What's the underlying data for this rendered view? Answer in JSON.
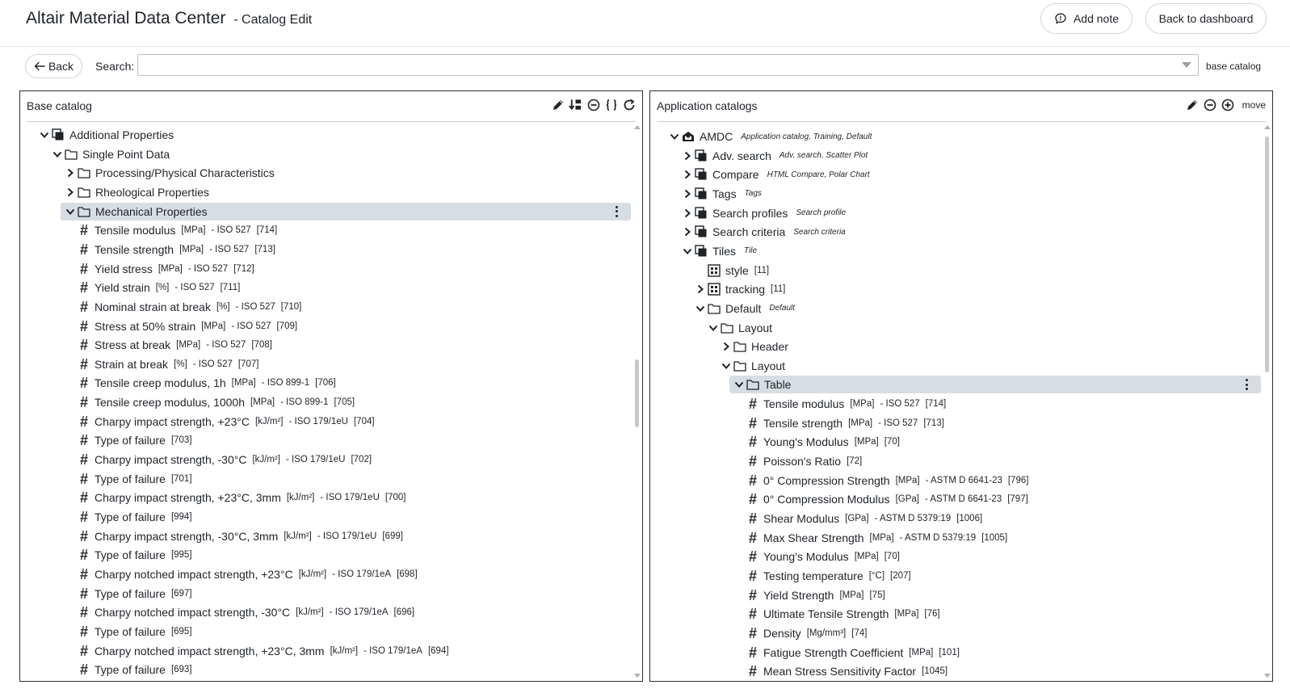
{
  "header": {
    "app_title": "Altair Material Data Center",
    "page_subtitle": "- Catalog Edit",
    "add_note_label": "Add note",
    "dashboard_label": "Back to dashboard"
  },
  "toolbar": {
    "back_label": "Back",
    "search_label": "Search:",
    "search_value": "",
    "search_scope": "base catalog"
  },
  "left_panel": {
    "title": "Base catalog",
    "tools": [
      "pencil-icon",
      "sort-icon",
      "collapse-all-icon",
      "braces-icon",
      "refresh-icon"
    ],
    "rows": [
      {
        "level": 1,
        "expand": "open",
        "icon": "catalog",
        "label": "Additional Properties"
      },
      {
        "level": 2,
        "expand": "open",
        "icon": "folder",
        "label": "Single Point Data"
      },
      {
        "level": 3,
        "expand": "closed",
        "icon": "folder",
        "label": "Processing/Physical Characteristics"
      },
      {
        "level": 3,
        "expand": "closed",
        "icon": "folder",
        "label": "Rheological Properties"
      },
      {
        "level": 3,
        "expand": "open",
        "icon": "folder",
        "label": "Mechanical Properties",
        "selected": true
      },
      {
        "level": 4,
        "icon": "hash",
        "label": "Tensile modulus",
        "unit": "[MPa]",
        "std": "- ISO 527",
        "id": "[714]"
      },
      {
        "level": 4,
        "icon": "hash",
        "label": "Tensile strength",
        "unit": "[MPa]",
        "std": "- ISO 527",
        "id": "[713]"
      },
      {
        "level": 4,
        "icon": "hash",
        "label": "Yield stress",
        "unit": "[MPa]",
        "std": "- ISO 527",
        "id": "[712]"
      },
      {
        "level": 4,
        "icon": "hash",
        "label": "Yield strain",
        "unit": "[%]",
        "std": "- ISO 527",
        "id": "[711]"
      },
      {
        "level": 4,
        "icon": "hash",
        "label": "Nominal strain at break",
        "unit": "[%]",
        "std": "- ISO 527",
        "id": "[710]"
      },
      {
        "level": 4,
        "icon": "hash",
        "label": "Stress at 50% strain",
        "unit": "[MPa]",
        "std": "- ISO 527",
        "id": "[709]"
      },
      {
        "level": 4,
        "icon": "hash",
        "label": "Stress at break",
        "unit": "[MPa]",
        "std": "- ISO 527",
        "id": "[708]"
      },
      {
        "level": 4,
        "icon": "hash",
        "label": "Strain at break",
        "unit": "[%]",
        "std": "- ISO 527",
        "id": "[707]"
      },
      {
        "level": 4,
        "icon": "hash",
        "label": "Tensile creep modulus, 1h",
        "unit": "[MPa]",
        "std": "- ISO 899-1",
        "id": "[706]"
      },
      {
        "level": 4,
        "icon": "hash",
        "label": "Tensile creep modulus, 1000h",
        "unit": "[MPa]",
        "std": "- ISO 899-1",
        "id": "[705]"
      },
      {
        "level": 4,
        "icon": "hash",
        "label": "Charpy impact strength, +23°C",
        "unit": "[kJ/m²]",
        "std": "- ISO 179/1eU",
        "id": "[704]"
      },
      {
        "level": 4,
        "icon": "hash",
        "label": "Type of failure",
        "id": "[703]"
      },
      {
        "level": 4,
        "icon": "hash",
        "label": "Charpy impact strength, -30°C",
        "unit": "[kJ/m²]",
        "std": "- ISO 179/1eU",
        "id": "[702]"
      },
      {
        "level": 4,
        "icon": "hash",
        "label": "Type of failure",
        "id": "[701]"
      },
      {
        "level": 4,
        "icon": "hash",
        "label": "Charpy impact strength, +23°C, 3mm",
        "unit": "[kJ/m²]",
        "std": "- ISO 179/1eU",
        "id": "[700]"
      },
      {
        "level": 4,
        "icon": "hash",
        "label": "Type of failure",
        "id": "[994]"
      },
      {
        "level": 4,
        "icon": "hash",
        "label": "Charpy impact strength, -30°C, 3mm",
        "unit": "[kJ/m²]",
        "std": "- ISO 179/1eU",
        "id": "[699]"
      },
      {
        "level": 4,
        "icon": "hash",
        "label": "Type of failure",
        "id": "[995]"
      },
      {
        "level": 4,
        "icon": "hash",
        "label": "Charpy notched impact strength, +23°C",
        "unit": "[kJ/m²]",
        "std": "- ISO 179/1eA",
        "id": "[698]"
      },
      {
        "level": 4,
        "icon": "hash",
        "label": "Type of failure",
        "id": "[697]"
      },
      {
        "level": 4,
        "icon": "hash",
        "label": "Charpy notched impact strength, -30°C",
        "unit": "[kJ/m²]",
        "std": "- ISO 179/1eA",
        "id": "[696]"
      },
      {
        "level": 4,
        "icon": "hash",
        "label": "Type of failure",
        "id": "[695]"
      },
      {
        "level": 4,
        "icon": "hash",
        "label": "Charpy notched impact strength, +23°C, 3mm",
        "unit": "[kJ/m²]",
        "std": "- ISO 179/1eA",
        "id": "[694]"
      },
      {
        "level": 4,
        "icon": "hash",
        "label": "Type of failure",
        "id": "[693]"
      }
    ]
  },
  "right_panel": {
    "title": "Application catalogs",
    "tools": [
      "pencil-icon",
      "collapse-all-icon",
      "expand-all-icon"
    ],
    "move_label": "move",
    "rows": [
      {
        "level": 1,
        "expand": "open",
        "icon": "app",
        "label": "AMDC",
        "tag": "Application catalog, Training, Default"
      },
      {
        "level": 2,
        "expand": "closed",
        "icon": "catalog",
        "label": "Adv. search",
        "tag": "Adv. search, Scatter Plot"
      },
      {
        "level": 2,
        "expand": "closed",
        "icon": "catalog",
        "label": "Compare",
        "tag": "HTML Compare, Polar Chart"
      },
      {
        "level": 2,
        "expand": "closed",
        "icon": "catalog",
        "label": "Tags",
        "tag": "Tags"
      },
      {
        "level": 2,
        "expand": "closed",
        "icon": "catalog",
        "label": "Search profiles",
        "tag": "Search profile"
      },
      {
        "level": 2,
        "expand": "closed",
        "icon": "catalog",
        "label": "Search criteria",
        "tag": "Search criteria"
      },
      {
        "level": 2,
        "expand": "open",
        "icon": "catalog",
        "label": "Tiles",
        "tag": "Tile"
      },
      {
        "level": 3,
        "icon": "grid",
        "label": "style",
        "id": "[11]"
      },
      {
        "level": 3,
        "expand": "closed",
        "icon": "grid",
        "label": "tracking",
        "id": "[11]"
      },
      {
        "level": 3,
        "expand": "open",
        "icon": "folder",
        "label": "Default",
        "tag": "Default"
      },
      {
        "level": 4,
        "expand": "open",
        "icon": "folder",
        "label": "Layout"
      },
      {
        "level": 5,
        "expand": "closed",
        "icon": "folder",
        "label": "Header"
      },
      {
        "level": 5,
        "expand": "open",
        "icon": "folder",
        "label": "Layout"
      },
      {
        "level": 6,
        "expand": "open",
        "icon": "folder",
        "label": "Table",
        "selected": true
      },
      {
        "level": 7,
        "icon": "hash",
        "label": "Tensile modulus",
        "unit": "[MPa]",
        "std": "- ISO 527",
        "id": "[714]"
      },
      {
        "level": 7,
        "icon": "hash",
        "label": "Tensile strength",
        "unit": "[MPa]",
        "std": "- ISO 527",
        "id": "[713]"
      },
      {
        "level": 7,
        "icon": "hash",
        "label": "Young's Modulus",
        "unit": "[MPa]",
        "id": "[70]"
      },
      {
        "level": 7,
        "icon": "hash",
        "label": "Poisson's Ratio",
        "id": "[72]"
      },
      {
        "level": 7,
        "icon": "hash",
        "label": "0° Compression Strength",
        "unit": "[MPa]",
        "std": "- ASTM D 6641-23",
        "id": "[796]"
      },
      {
        "level": 7,
        "icon": "hash",
        "label": "0° Compression Modulus",
        "unit": "[GPa]",
        "std": "- ASTM D 6641-23",
        "id": "[797]"
      },
      {
        "level": 7,
        "icon": "hash",
        "label": "Shear Modulus",
        "unit": "[GPa]",
        "std": "- ASTM D 5379:19",
        "id": "[1006]"
      },
      {
        "level": 7,
        "icon": "hash",
        "label": "Max Shear Strength",
        "unit": "[MPa]",
        "std": "- ASTM D 5379:19",
        "id": "[1005]"
      },
      {
        "level": 7,
        "icon": "hash",
        "label": "Young's Modulus",
        "unit": "[MPa]",
        "id": "[70]"
      },
      {
        "level": 7,
        "icon": "hash",
        "label": "Testing temperature",
        "unit": "[°C]",
        "id": "[207]"
      },
      {
        "level": 7,
        "icon": "hash",
        "label": "Yield Strength",
        "unit": "[MPa]",
        "id": "[75]"
      },
      {
        "level": 7,
        "icon": "hash",
        "label": "Ultimate Tensile Strength",
        "unit": "[MPa]",
        "id": "[76]"
      },
      {
        "level": 7,
        "icon": "hash",
        "label": "Density",
        "unit": "[Mg/mm³]",
        "id": "[74]"
      },
      {
        "level": 7,
        "icon": "hash",
        "label": "Fatigue Strength Coefficient",
        "unit": "[MPa]",
        "id": "[101]"
      },
      {
        "level": 7,
        "icon": "hash",
        "label": "Mean Stress Sensitivity Factor",
        "id": "[1045]"
      }
    ]
  }
}
